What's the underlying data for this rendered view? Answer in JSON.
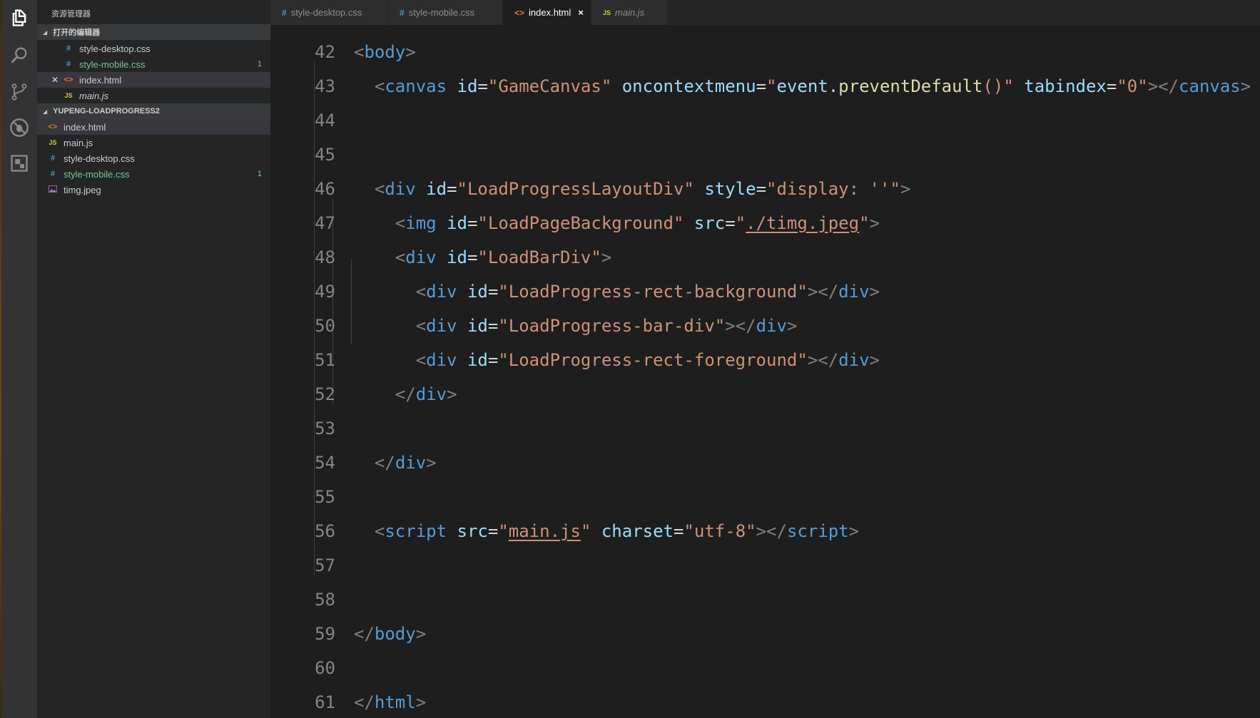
{
  "sidebar": {
    "title": "资源管理器",
    "open_editors": {
      "header": "打开的编辑器",
      "items": [
        {
          "name": "style-desktop.css",
          "icon": "#",
          "badge": ""
        },
        {
          "name": "style-mobile.css",
          "icon": "#",
          "badge": "1"
        },
        {
          "name": "index.html",
          "icon": "<>",
          "badge": ""
        },
        {
          "name": "main.js",
          "icon": "JS",
          "badge": ""
        }
      ]
    },
    "project": {
      "header": "YUPENG-LOADPROGRESS2",
      "items": [
        {
          "name": "index.html",
          "icon": "<>",
          "badge": ""
        },
        {
          "name": "main.js",
          "icon": "JS",
          "badge": ""
        },
        {
          "name": "style-desktop.css",
          "icon": "#",
          "badge": ""
        },
        {
          "name": "style-mobile.css",
          "icon": "#",
          "badge": "1"
        },
        {
          "name": "timg.jpeg",
          "icon": "image-icon",
          "badge": ""
        }
      ]
    }
  },
  "tabs": [
    {
      "label": "style-desktop.css",
      "icon": "#"
    },
    {
      "label": "style-mobile.css",
      "icon": "#"
    },
    {
      "label": "index.html",
      "icon": "<>",
      "close": "×"
    },
    {
      "label": "main.js",
      "icon": "JS"
    }
  ],
  "editor": {
    "lines": [
      {
        "num": "42",
        "tokens": [
          [
            "p",
            "<"
          ],
          [
            "tag",
            "body"
          ],
          [
            "p",
            ">"
          ]
        ]
      },
      {
        "num": "43",
        "tokens": [
          [
            "op",
            "  "
          ],
          [
            "p",
            "<"
          ],
          [
            "tag",
            "canvas"
          ],
          [
            "op",
            " "
          ],
          [
            "attr",
            "id"
          ],
          [
            "op",
            "="
          ],
          [
            "str",
            "\"GameCanvas\""
          ],
          [
            "op",
            " "
          ],
          [
            "attr",
            "oncontextmenu"
          ],
          [
            "op",
            "="
          ],
          [
            "str",
            "\""
          ],
          [
            "obj",
            "event"
          ],
          [
            "op",
            "."
          ],
          [
            "fn",
            "preventDefault"
          ],
          [
            "str",
            "()\""
          ],
          [
            "op",
            " "
          ],
          [
            "attr",
            "tabindex"
          ],
          [
            "op",
            "="
          ],
          [
            "str",
            "\"0\""
          ],
          [
            "p",
            "></"
          ],
          [
            "tag",
            "canvas"
          ],
          [
            "p",
            ">"
          ]
        ]
      },
      {
        "num": "44",
        "tokens": []
      },
      {
        "num": "45",
        "tokens": []
      },
      {
        "num": "46",
        "tokens": [
          [
            "op",
            "  "
          ],
          [
            "p",
            "<"
          ],
          [
            "tag",
            "div"
          ],
          [
            "op",
            " "
          ],
          [
            "attr",
            "id"
          ],
          [
            "op",
            "="
          ],
          [
            "str",
            "\"LoadProgressLayoutDiv\""
          ],
          [
            "op",
            " "
          ],
          [
            "attr",
            "style"
          ],
          [
            "op",
            "="
          ],
          [
            "str",
            "\"display: ''\""
          ],
          [
            "p",
            ">"
          ]
        ]
      },
      {
        "num": "47",
        "tokens": [
          [
            "op",
            "    "
          ],
          [
            "p",
            "<"
          ],
          [
            "tag",
            "img"
          ],
          [
            "op",
            " "
          ],
          [
            "attr",
            "id"
          ],
          [
            "op",
            "="
          ],
          [
            "str",
            "\"LoadPageBackground\""
          ],
          [
            "op",
            " "
          ],
          [
            "attr",
            "src"
          ],
          [
            "op",
            "="
          ],
          [
            "str",
            "\""
          ],
          [
            "link",
            "./timg.jpeg"
          ],
          [
            "str",
            "\""
          ],
          [
            "p",
            ">"
          ]
        ]
      },
      {
        "num": "48",
        "tokens": [
          [
            "op",
            "    "
          ],
          [
            "p",
            "<"
          ],
          [
            "tag",
            "div"
          ],
          [
            "op",
            " "
          ],
          [
            "attr",
            "id"
          ],
          [
            "op",
            "="
          ],
          [
            "str",
            "\"LoadBarDiv\""
          ],
          [
            "p",
            ">"
          ]
        ]
      },
      {
        "num": "49",
        "tokens": [
          [
            "op",
            "      "
          ],
          [
            "p",
            "<"
          ],
          [
            "tag",
            "div"
          ],
          [
            "op",
            " "
          ],
          [
            "attr",
            "id"
          ],
          [
            "op",
            "="
          ],
          [
            "str",
            "\"LoadProgress-rect-background\""
          ],
          [
            "p",
            "></"
          ],
          [
            "tag",
            "div"
          ],
          [
            "p",
            ">"
          ]
        ]
      },
      {
        "num": "50",
        "tokens": [
          [
            "op",
            "      "
          ],
          [
            "p",
            "<"
          ],
          [
            "tag",
            "div"
          ],
          [
            "op",
            " "
          ],
          [
            "attr",
            "id"
          ],
          [
            "op",
            "="
          ],
          [
            "str",
            "\"LoadProgress-bar-div\""
          ],
          [
            "p",
            "></"
          ],
          [
            "tag",
            "div"
          ],
          [
            "p",
            ">"
          ]
        ]
      },
      {
        "num": "51",
        "tokens": [
          [
            "op",
            "      "
          ],
          [
            "p",
            "<"
          ],
          [
            "tag",
            "div"
          ],
          [
            "op",
            " "
          ],
          [
            "attr",
            "id"
          ],
          [
            "op",
            "="
          ],
          [
            "str",
            "\"LoadProgress-rect-foreground\""
          ],
          [
            "p",
            "></"
          ],
          [
            "tag",
            "div"
          ],
          [
            "p",
            ">"
          ]
        ]
      },
      {
        "num": "52",
        "tokens": [
          [
            "op",
            "    "
          ],
          [
            "p",
            "</"
          ],
          [
            "tag",
            "div"
          ],
          [
            "p",
            ">"
          ]
        ]
      },
      {
        "num": "53",
        "tokens": []
      },
      {
        "num": "54",
        "tokens": [
          [
            "op",
            "  "
          ],
          [
            "p",
            "</"
          ],
          [
            "tag",
            "div"
          ],
          [
            "p",
            ">"
          ]
        ]
      },
      {
        "num": "55",
        "tokens": []
      },
      {
        "num": "56",
        "tokens": [
          [
            "op",
            "  "
          ],
          [
            "p",
            "<"
          ],
          [
            "tag",
            "script"
          ],
          [
            "op",
            " "
          ],
          [
            "attr",
            "src"
          ],
          [
            "op",
            "="
          ],
          [
            "str",
            "\""
          ],
          [
            "link",
            "main.js"
          ],
          [
            "str",
            "\""
          ],
          [
            "op",
            " "
          ],
          [
            "attr",
            "charset"
          ],
          [
            "op",
            "="
          ],
          [
            "str",
            "\"utf-8\""
          ],
          [
            "p",
            "></"
          ],
          [
            "tag",
            "script"
          ],
          [
            "p",
            ">"
          ]
        ]
      },
      {
        "num": "57",
        "tokens": []
      },
      {
        "num": "58",
        "tokens": []
      },
      {
        "num": "59",
        "tokens": [
          [
            "p",
            "</"
          ],
          [
            "tag",
            "body"
          ],
          [
            "p",
            ">"
          ]
        ]
      },
      {
        "num": "60",
        "tokens": []
      },
      {
        "num": "61",
        "tokens": [
          [
            "p",
            "</"
          ],
          [
            "tag",
            "html"
          ],
          [
            "p",
            ">"
          ]
        ]
      }
    ]
  },
  "colors": {
    "tag": "#569cd6",
    "attr": "#9cdcfe",
    "string": "#ce9178",
    "function": "#dcdcaa",
    "punct": "#808080",
    "modified": "#73c991"
  }
}
